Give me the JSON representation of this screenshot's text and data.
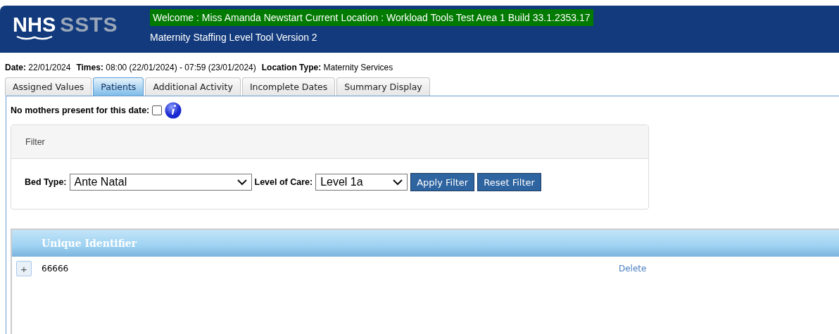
{
  "header": {
    "logo_main": "NHS",
    "logo_sub": "SSTS",
    "welcome": "Welcome : Miss Amanda Newstart Current Location : Workload Tools Test Area 1 Build 33.1.2353.17",
    "subtitle": "Maternity Staffing Level Tool Version 2"
  },
  "info": [
    {
      "label": "Date:",
      "value": "22/01/2024"
    },
    {
      "label": "Times:",
      "value": "08:00 (22/01/2024) - 07:59 (23/01/2024)"
    },
    {
      "label": "Location Type:",
      "value": "Maternity Services"
    }
  ],
  "tabs": [
    {
      "label": "Assigned Values",
      "selected": false
    },
    {
      "label": "Patients",
      "selected": true
    },
    {
      "label": "Additional Activity",
      "selected": false
    },
    {
      "label": "Incomplete Dates",
      "selected": false
    },
    {
      "label": "Summary Display",
      "selected": false
    }
  ],
  "no_mothers": {
    "label": "No mothers present for this date:",
    "checked": false
  },
  "filter": {
    "title": "Filter",
    "bed_type": {
      "label": "Bed Type:",
      "value": "Ante Natal"
    },
    "level_of_care": {
      "label": "Level of Care:",
      "value": "Level 1a"
    },
    "buttons": [
      "Apply Filter",
      "Reset Filter"
    ]
  },
  "table": {
    "columns": [
      "Unique Identifier"
    ],
    "rows": [
      {
        "expand": "+",
        "id": "66666",
        "action": "Delete"
      }
    ]
  }
}
